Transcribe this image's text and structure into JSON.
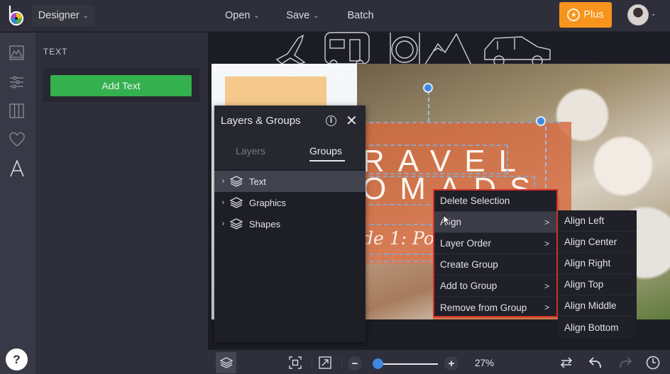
{
  "topbar": {
    "mode_label": "Designer",
    "menu": [
      {
        "label": "Open",
        "has_dropdown": true
      },
      {
        "label": "Save",
        "has_dropdown": true
      },
      {
        "label": "Batch",
        "has_dropdown": false
      }
    ],
    "plus_label": "Plus",
    "accent_color": "#f7941d"
  },
  "icon_rail": {
    "items": [
      "image-icon",
      "adjustments-icon",
      "frames-icon",
      "heart-icon",
      "text-icon"
    ],
    "active": "text-icon",
    "help_label": "?"
  },
  "side_panel": {
    "title": "TEXT",
    "add_button_label": "Add Text",
    "add_button_color": "#34b04f"
  },
  "canvas": {
    "title_line1": "RAVEL",
    "title_line2": "OMADS",
    "subtitle": "de 1: Pos"
  },
  "layers_panel": {
    "title": "Layers & Groups",
    "tabs": [
      {
        "label": "Layers",
        "active": false
      },
      {
        "label": "Groups",
        "active": true
      }
    ],
    "groups": [
      {
        "label": "Text",
        "active": true
      },
      {
        "label": "Graphics",
        "active": false
      },
      {
        "label": "Shapes",
        "active": false
      }
    ]
  },
  "context_menu": {
    "items": [
      {
        "label": "Delete Selection",
        "has_submenu": false
      },
      {
        "label": "Align",
        "has_submenu": true,
        "active": true
      },
      {
        "label": "Layer Order",
        "has_submenu": true
      },
      {
        "label": "Create Group",
        "has_submenu": false
      },
      {
        "label": "Add to Group",
        "has_submenu": true
      },
      {
        "label": "Remove from Group",
        "has_submenu": true
      }
    ],
    "border_color": "#d0302a"
  },
  "align_submenu": {
    "items": [
      "Align Left",
      "Align Center",
      "Align Right",
      "Align Top",
      "Align Middle",
      "Align Bottom"
    ]
  },
  "bottombar": {
    "zoom_percent": "27%",
    "zoom_value": 27
  }
}
